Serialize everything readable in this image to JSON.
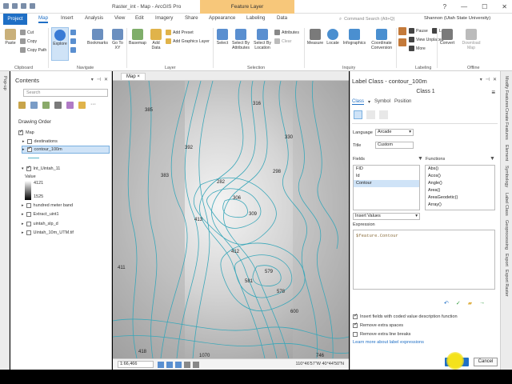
{
  "titlebar": {
    "title": "Raster_int - Map - ArcGIS Pro",
    "context_tab": "Feature Layer",
    "window_controls": [
      "?",
      "—",
      "☐",
      "✕"
    ]
  },
  "tabs": {
    "project": "Project",
    "items": [
      "Map",
      "Insert",
      "Analysis",
      "View",
      "Edit",
      "Imagery",
      "Share",
      "Appearance",
      "Labeling",
      "Data"
    ],
    "active": "Map"
  },
  "search": {
    "placeholder": "Command Search (Alt+Q)"
  },
  "user": {
    "name": "Shannon (Utah State University)"
  },
  "ribbon": {
    "clipboard": {
      "paste": "Paste",
      "cut": "Cut",
      "copy": "Copy",
      "copy_path": "Copy Path",
      "label": "Clipboard"
    },
    "navigate": {
      "explore": "Explore",
      "bookmarks": "Bookmarks",
      "goto": "Go To XY",
      "label": "Navigate"
    },
    "layer": {
      "basemap": "Basemap",
      "add_data": "Add Data",
      "add_preset": "Add Preset",
      "add_graphics": "Add Graphics Layer",
      "label": "Layer"
    },
    "selection": {
      "select": "Select",
      "by_attr": "Select By Attributes",
      "by_loc": "Select By Location",
      "attributes": "Attributes",
      "clear": "Clear",
      "label": "Selection"
    },
    "inquiry": {
      "measure": "Measure",
      "locate": "Locate",
      "infographics": "Infographics",
      "coord": "Coordinate Conversion",
      "label": "Inquiry"
    },
    "labeling": {
      "pause": "Pause",
      "lock": "Lock",
      "view_unplaced": "View Unplaced",
      "more": "More",
      "label": "Labeling"
    },
    "offline": {
      "convert": "Convert",
      "download": "Download Map",
      "label": "Offline"
    }
  },
  "left_strip": {
    "label": "Pop-up"
  },
  "contents": {
    "title": "Contents",
    "search_placeholder": "Search",
    "drawing_order": "Drawing Order",
    "layers": [
      {
        "name": "Map",
        "checked": true
      },
      {
        "name": "destinations",
        "checked": false
      },
      {
        "name": "contour_100m",
        "checked": true
      },
      {
        "name": "Int_Uintah_11",
        "checked": true
      },
      {
        "name": "Value",
        "checked": false
      },
      {
        "name": "4121",
        "checked": false
      },
      {
        "name": "1525",
        "checked": false
      },
      {
        "name": "hundred meter band",
        "checked": false
      },
      {
        "name": "Extract_uint1",
        "checked": false
      },
      {
        "name": "uintah_slp_d",
        "checked": false
      },
      {
        "name": "Uintah_10m_UTM.tif",
        "checked": false
      }
    ]
  },
  "map": {
    "tab": "Map",
    "scale": "1:66,466",
    "coords": "110°46'57\"W 40°44'50\"N",
    "labels": [
      "385",
      "411",
      "412",
      "413",
      "383",
      "392",
      "282",
      "306",
      "316",
      "330",
      "418",
      "1070",
      "746",
      "309",
      "298",
      "579",
      "578",
      "581",
      "600"
    ]
  },
  "label_class": {
    "title": "Label Class - contour_100m",
    "class_name": "Class 1",
    "tabs": [
      "Class",
      "Symbol",
      "Position"
    ],
    "active_tab": "Class",
    "language_label": "Language",
    "language_value": "Arcade",
    "title_label": "Title",
    "title_value": "Custom",
    "fields_label": "Fields",
    "fields": [
      "FID",
      "Id",
      "Contour"
    ],
    "selected_field": "Contour",
    "functions_label": "Functions",
    "functions": [
      "Abs()",
      "Acos()",
      "Angle()",
      "Area()",
      "AreaGeodetic()",
      "Array()"
    ],
    "insert_values": "Insert Values",
    "expression_label": "Expression",
    "expression": "$feature.Contour",
    "options": [
      {
        "label": "Insert fields with coded value description function",
        "checked": true
      },
      {
        "label": "Remove extra spaces",
        "checked": true
      },
      {
        "label": "Remove extra line breaks",
        "checked": false
      }
    ],
    "learn_more": "Learn more about label expressions",
    "cancel": "Cancel"
  },
  "right_strip": [
    "Modify Features",
    "Create Features",
    "Element",
    "Symbology",
    "Label Class",
    "Geoprocessing",
    "Export",
    "Export Raster"
  ]
}
